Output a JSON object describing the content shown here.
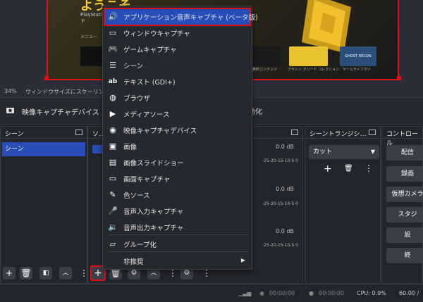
{
  "preview": {
    "title": "ようこそ",
    "subtitle": "PlayStation… ード",
    "menu_label": "メニュー",
    "tiles": [
      "ファ…",
      "…",
      "…",
      "…",
      "無料コンテンツ",
      "アサシン クリード コレクション",
      "ゲームライブラリ"
    ],
    "tile_logo": "GHOST RECON"
  },
  "scale_row": {
    "percent": "34%",
    "message": "ウィンドウサイズにスケーリング表"
  },
  "context_bar": {
    "source_label": "映像キャプチャデバイス",
    "right_label": "効化"
  },
  "docks": {
    "scenes": {
      "title": "シーン",
      "items": [
        "シーン"
      ]
    },
    "sources": {
      "title": "ソ…"
    },
    "mixer": {
      "channels": [
        {
          "db": "0.0 dB",
          "scale": "-25-20-15-10-5 0"
        },
        {
          "db": "0.0 dB",
          "scale": "-25-20-15-10-5 0"
        },
        {
          "db": "0.0 dB",
          "scale": "-25-20-15-10-5 0"
        }
      ]
    },
    "transitions": {
      "title": "シーントランジシ…",
      "selected": "カット"
    },
    "controls": {
      "title": "コントロール",
      "buttons": [
        "配信",
        "録画",
        "仮想カメラ",
        "スタジ",
        "設",
        "終"
      ]
    }
  },
  "menu": {
    "items": [
      {
        "icon": "speaker-icon",
        "glyph": "🔊",
        "label": "アプリケーション音声キャプチャ (ベータ版)",
        "selected": true
      },
      {
        "icon": "window-icon",
        "glyph": "▭",
        "label": "ウィンドウキャプチャ"
      },
      {
        "icon": "gamepad-icon",
        "glyph": "🎮",
        "label": "ゲームキャプチャ"
      },
      {
        "icon": "list-icon",
        "glyph": "☰",
        "label": "シーン"
      },
      {
        "icon": "text-icon",
        "glyph": "ab",
        "label": "テキスト (GDI+)"
      },
      {
        "icon": "globe-icon",
        "glyph": "◍",
        "label": "ブラウザ"
      },
      {
        "icon": "play-icon",
        "glyph": "▶",
        "label": "メディアソース"
      },
      {
        "icon": "camera-icon",
        "glyph": "◉",
        "label": "映像キャプチャデバイス"
      },
      {
        "icon": "image-icon",
        "glyph": "▣",
        "label": "画像"
      },
      {
        "icon": "slideshow-icon",
        "glyph": "▤",
        "label": "画像スライドショー"
      },
      {
        "icon": "monitor-icon",
        "glyph": "▭",
        "label": "画面キャプチャ"
      },
      {
        "icon": "brush-icon",
        "glyph": "✎",
        "label": "色ソース"
      },
      {
        "icon": "microphone-icon",
        "glyph": "🎤",
        "label": "音声入力キャプチャ"
      },
      {
        "icon": "speaker-out-icon",
        "glyph": "🔉",
        "label": "音声出力キャプチャ"
      },
      {
        "icon": "folder-icon",
        "glyph": "▱",
        "label": "グループ化"
      },
      {
        "icon": "none",
        "glyph": "",
        "label": "非推奨"
      }
    ]
  },
  "statusbar": {
    "rec_time": "00:00:00",
    "stream_time": "00:00:00",
    "cpu": "CPU: 0.9%",
    "fps": "60.00 /"
  },
  "colors": {
    "accent": "#284cb8",
    "highlight": "#e01010",
    "bg": "#1e1f26"
  }
}
